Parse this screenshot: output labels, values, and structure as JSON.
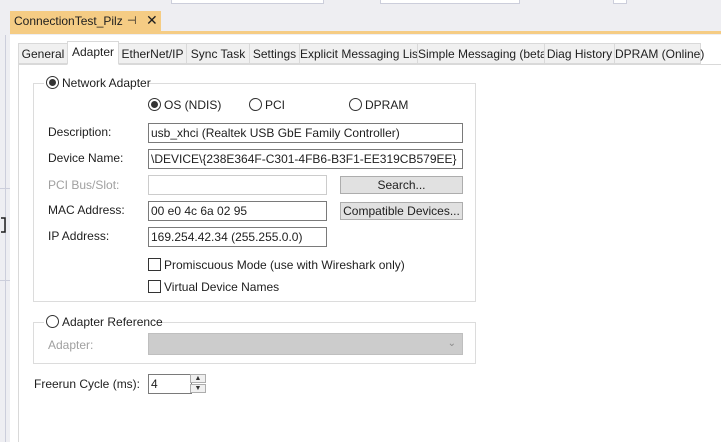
{
  "document_tab": {
    "title": "ConnectionTest_Pilz",
    "pin_icon": "pin-icon",
    "close_icon": "close-icon"
  },
  "tabs": [
    {
      "label": "General"
    },
    {
      "label": "Adapter",
      "active": true
    },
    {
      "label": "EtherNet/IP"
    },
    {
      "label": "Sync Task"
    },
    {
      "label": "Settings"
    },
    {
      "label": "Explicit Messaging List"
    },
    {
      "label": "Simple Messaging (beta)"
    },
    {
      "label": "Diag History"
    },
    {
      "label": "DPRAM (Online)"
    }
  ],
  "network_adapter": {
    "label": "Network Adapter",
    "selected": true,
    "modes": [
      {
        "label": "OS (NDIS)",
        "selected": true
      },
      {
        "label": "PCI",
        "selected": false
      },
      {
        "label": "DPRAM",
        "selected": false
      }
    ],
    "description_label": "Description:",
    "description_value": "usb_xhci (Realtek USB GbE Family Controller)",
    "device_name_label": "Device Name:",
    "device_name_value": "\\DEVICE\\{238E364F-C301-4FB6-B3F1-EE319CB579EE}",
    "pci_bus_label": "PCI Bus/Slot:",
    "pci_bus_value": "",
    "search_button": "Search...",
    "mac_label": "MAC Address:",
    "mac_value": "00 e0 4c 6a 02 95",
    "compatible_button": "Compatible Devices...",
    "ip_label": "IP Address:",
    "ip_value": "169.254.42.34 (255.255.0.0)",
    "promiscuous_label": "Promiscuous Mode (use with Wireshark only)",
    "promiscuous_checked": false,
    "virtual_names_label": "Virtual Device Names",
    "virtual_names_checked": false
  },
  "adapter_reference": {
    "label": "Adapter Reference",
    "selected": false,
    "adapter_label": "Adapter:",
    "adapter_value": "",
    "dropdown_icon": "chevron-down-icon"
  },
  "freerun": {
    "label": "Freerun Cycle (ms):",
    "value": "4"
  },
  "colors": {
    "active_doc_tab": "#f5cc84",
    "chrome": "#eeeef2"
  }
}
